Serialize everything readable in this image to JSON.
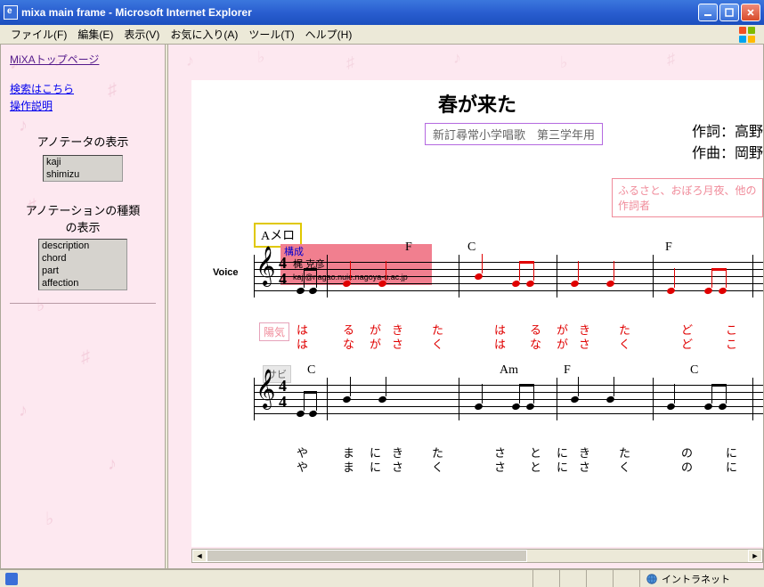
{
  "window": {
    "title": "mixa main frame - Microsoft Internet Explorer"
  },
  "menubar": {
    "file": "ファイル(F)",
    "edit": "編集(E)",
    "view": "表示(V)",
    "favorites": "お気に入り(A)",
    "tools": "ツール(T)",
    "help": "ヘルプ(H)"
  },
  "sidebar": {
    "top_link": "MiXAトップページ",
    "search_link": "検索はこちら",
    "manual_link": "操作説明",
    "annotator_header": "アノテータの表示",
    "annotators": [
      "kaji",
      "shimizu"
    ],
    "annotation_type_header1": "アノテーションの種類",
    "annotation_type_header2": "の表示",
    "annotation_types": [
      "description",
      "chord",
      "part",
      "affection"
    ]
  },
  "score": {
    "title": "春が来た",
    "subtitle": "新訂尋常小学唱歌　第三学年用",
    "credit_lyric": "作詞：高野",
    "credit_music": "作曲：岡野",
    "note_text": "ふるさと、おぼろ月夜、他の作詞者",
    "voice_label": "Voice",
    "section1_label": "Aメロ",
    "annot_header": "構成",
    "annot_name": "梶 克彦",
    "annot_email": "kaji@nagao.nuie.nagoya-u.ac.jp",
    "mood_tag": "陽気",
    "sabi_tag": "サビ",
    "chords_line1": [
      "F",
      "C",
      "F"
    ],
    "chords_line2": [
      "C",
      "Am",
      "F",
      "C"
    ],
    "lyrics_line1_row1": [
      "は",
      "る",
      "が",
      "き",
      "た",
      "は",
      "る",
      "が",
      "き",
      "た",
      "ど",
      "こ"
    ],
    "lyrics_line1_row2": [
      "は",
      "な",
      "が",
      "さ",
      "く",
      "は",
      "な",
      "が",
      "さ",
      "く",
      "ど",
      "こ"
    ],
    "lyrics_line2_row1": [
      "や",
      "ま",
      "に",
      "き",
      "た",
      "さ",
      "と",
      "に",
      "き",
      "た",
      "の",
      "に"
    ],
    "lyrics_line2_row2": [
      "や",
      "ま",
      "に",
      "さ",
      "く",
      "さ",
      "と",
      "に",
      "さ",
      "く",
      "の",
      "に"
    ]
  },
  "statusbar": {
    "zone": "イントラネット"
  }
}
